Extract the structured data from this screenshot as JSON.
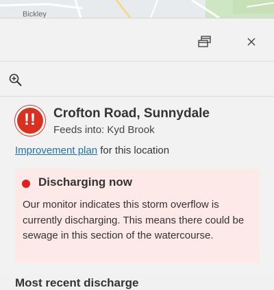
{
  "map": {
    "place_label": "Bickley"
  },
  "toolbar": {
    "dock_icon": "dock-window-icon",
    "close_icon": "close-icon"
  },
  "zoom": {
    "icon": "zoom-in-icon"
  },
  "location": {
    "title": "Crofton Road, Sunnydale",
    "feeds_into": "Feeds into: Kyd Brook",
    "badge_text": "!!",
    "badge_color": "#d8311f"
  },
  "improvement": {
    "link_text": "Improvement plan",
    "suffix": " for this location",
    "link_color": "#1d70b8"
  },
  "status": {
    "title": "Discharging now",
    "body": "Our monitor indicates this storm overflow is currently discharging. This means there could be sewage in this section of the watercourse.",
    "dot_color": "#e01e1e",
    "background": "#fde9e7"
  },
  "recent": {
    "heading": "Most recent discharge"
  }
}
